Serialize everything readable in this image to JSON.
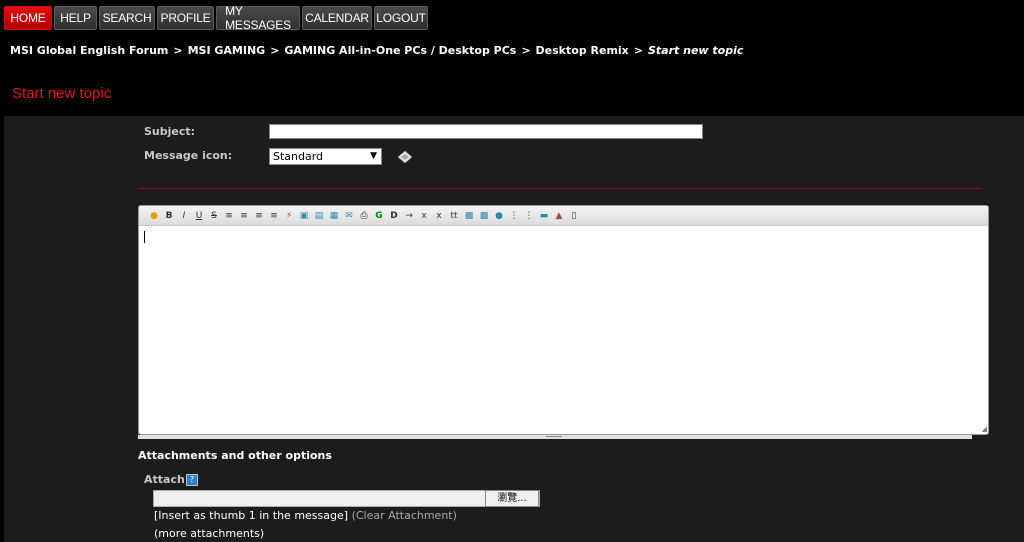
{
  "nav": {
    "items": [
      "HOME",
      "HELP",
      "SEARCH",
      "PROFILE",
      "MY MESSAGES",
      "CALENDAR",
      "LOGOUT"
    ]
  },
  "breadcrumb": {
    "items": [
      "MSI Global English Forum",
      "MSI GAMING",
      "GAMING All-in-One PCs / Desktop PCs",
      "Desktop Remix"
    ],
    "current": "Start new topic",
    "separator": ">"
  },
  "page_title": "Start new topic",
  "form": {
    "subject_label": "Subject:",
    "subject_value": "",
    "message_icon_label": "Message icon:",
    "message_icon_value": "Standard"
  },
  "editor": {
    "toolbar_icons": [
      "smiley-icon",
      "bold-icon",
      "italic-icon",
      "underline-icon",
      "strikethrough-icon",
      "align-left-icon",
      "align-center-icon",
      "align-right-icon",
      "justify-icon",
      "flash-icon",
      "image-icon",
      "link-icon",
      "table-icon",
      "email-icon",
      "print-icon",
      "glow-icon",
      "shadow-icon",
      "hr-icon",
      "subscript-icon",
      "superscript-icon",
      "teletype-icon",
      "code-icon",
      "quote-icon",
      "list-icon",
      "ordered-list-icon",
      "move-icon",
      "font-icon",
      "preview-icon"
    ],
    "content": ""
  },
  "attachments": {
    "heading": "Attachments and other options",
    "attach_label": "Attach:",
    "browse_label": "瀏覽...",
    "insert_text": "[Insert as thumb 1 in the message]",
    "clear_text": "(Clear Attachment)",
    "more_text": "(more attachments)"
  },
  "colors": {
    "accent": "#e51515",
    "nav_active": "#c40000",
    "panel_bg": "#1c1c1c"
  }
}
